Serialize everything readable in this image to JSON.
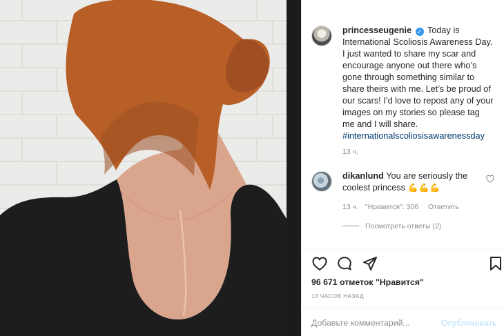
{
  "post": {
    "username": "princesseugenie",
    "caption": "Today is International Scoliosis Awareness Day. I just wanted to share my scar and encourage anyone out there who’s gone through something similar to share theirs with me. Let’s be proud of our scars! I’d love to repost any of your images on my stories so please tag me and I will share.",
    "hashtag": "#internationalscoliosisawarenessday",
    "time": "13 ч."
  },
  "comment": {
    "username": "dikanlund",
    "text": "You are seriously the coolest princess",
    "emoji": "💪💪💪",
    "time": "13 ч.",
    "likes": "\"Нравится\": 306",
    "reply": "Ответить",
    "view_replies": "Посмотреть ответы (2)"
  },
  "engagement": {
    "likes": "96 671 отметок \"Нравится\"",
    "posted": "13 часов назад"
  },
  "composer": {
    "placeholder": "Добавьте комментарий...",
    "publish": "Опубликовать"
  },
  "icons": {
    "like": "heart-icon",
    "comment": "comment-icon",
    "share": "send-icon",
    "save": "bookmark-icon",
    "comment_like": "small-heart-icon",
    "verified": "verified-badge-icon"
  },
  "colors": {
    "text": "#262626",
    "muted": "#8e8e8e",
    "hashtag": "#00376b",
    "verified": "#3897f0",
    "publish": "#b2dffc"
  }
}
